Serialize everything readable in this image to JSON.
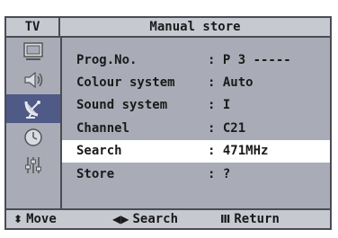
{
  "window": {
    "tag": "TV",
    "title": "Manual store"
  },
  "sidebar": {
    "icons": [
      {
        "name": "picture-icon",
        "active": false
      },
      {
        "name": "sound-icon",
        "active": false
      },
      {
        "name": "channel-icon",
        "active": true
      },
      {
        "name": "time-icon",
        "active": false
      },
      {
        "name": "setup-icon",
        "active": false
      }
    ]
  },
  "menu": {
    "rows": [
      {
        "label": "Prog.No.",
        "value": ": P 3 -----"
      },
      {
        "label": "Colour system",
        "value": ": Auto"
      },
      {
        "label": "Sound system",
        "value": ": I"
      },
      {
        "label": "Channel",
        "value": ": C21"
      },
      {
        "label": "Search",
        "value": ": 471MHz",
        "highlighted": true
      },
      {
        "label": "Store",
        "value": ": ?"
      }
    ]
  },
  "footer": {
    "move": {
      "glyph": "⬍",
      "label": "Move"
    },
    "search": {
      "glyph": "◀▶",
      "label": "Search"
    },
    "return": {
      "glyph": "Ⅲ",
      "label": "Return"
    }
  },
  "colors": {
    "panel": "#a9acb7",
    "bar": "#c7c9d1",
    "active_icon": "#4f5a86",
    "highlight": "#ffffff"
  }
}
